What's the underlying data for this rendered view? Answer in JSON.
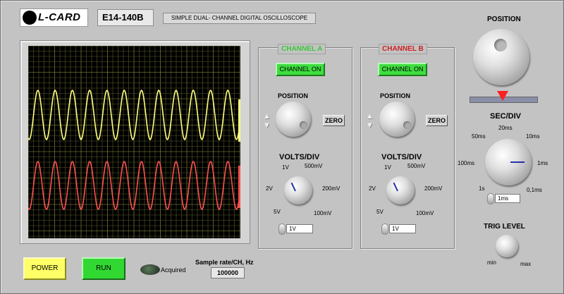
{
  "header": {
    "logo_text": "L-CARD",
    "model": "E14-140B",
    "subtitle": "SIMPLE DUAL- CHANNEL DIGITAL OSCILLOSCOPE"
  },
  "channel_a": {
    "title": "CHANNEL A",
    "title_color": "#3cc63c",
    "on_label": "CHANNEL ON",
    "position_label": "POSITION",
    "zero_label": "ZERO",
    "volts_label": "VOLTS/DIV",
    "scale": [
      "1V",
      "500mV",
      "2V",
      "200mV",
      "5V",
      "100mV"
    ],
    "value": "1V"
  },
  "channel_b": {
    "title": "CHANNEL B",
    "title_color": "#cc2222",
    "on_label": "CHANNEL ON",
    "position_label": "POSITION",
    "zero_label": "ZERO",
    "volts_label": "VOLTS/DIV",
    "scale": [
      "1V",
      "500mV",
      "2V",
      "200mV",
      "5V",
      "100mV"
    ],
    "value": "1V"
  },
  "horizontal": {
    "position_label": "POSITION",
    "sec_div_label": "SEC/DIV",
    "scale": [
      "20ms",
      "50ms",
      "10ms",
      "100ms",
      "1ms",
      "1s",
      "0,1ms"
    ],
    "value": "1ms"
  },
  "trigger": {
    "label": "TRIG LEVEL",
    "min": "min",
    "max": "max"
  },
  "bottom": {
    "power": "POWER",
    "run": "RUN",
    "led_label": "Acquired",
    "sample_label": "Sample rate/CH, Hz",
    "sample_value": "100000"
  },
  "colors": {
    "trace_a": "#ffff80",
    "trace_b": "#ff5050",
    "grid": "#8a8a3a",
    "led_green": "#3cd23c",
    "power_yellow": "#ffff66",
    "marker_red": "#ff2020"
  }
}
